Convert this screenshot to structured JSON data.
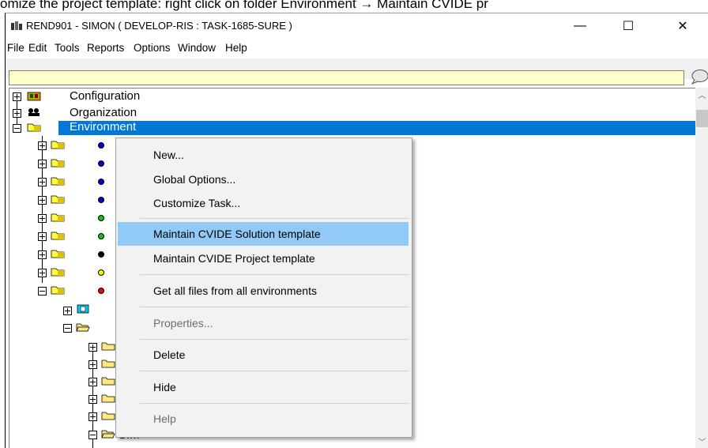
{
  "doc_line": "omize the project template: right click on folder Environment → Maintain CVIDE pr",
  "window": {
    "title": "REND901 - SIMON ( DEVELOP-RIS : TASK-1685-SURE )",
    "minimize": "—",
    "maximize": "☐",
    "close": "✕"
  },
  "menubar": [
    "File",
    "Edit",
    "Tools",
    "Reports",
    "Options",
    "Window",
    "Help"
  ],
  "command_input": {
    "value": ""
  },
  "tree": {
    "configuration": "Configuration",
    "organization": "Organization",
    "environment": "Environment",
    "sim": "SIM",
    "dot_colors": [
      "#0000cc",
      "#0000cc",
      "#0000cc",
      "#0000cc",
      "#00cc00",
      "#00cc00",
      "#000000",
      "#ffff00",
      "#ff0000"
    ]
  },
  "context_menu": {
    "items": [
      {
        "label": "New...",
        "state": "normal"
      },
      {
        "label": "Global Options...",
        "state": "normal"
      },
      {
        "label": "Customize Task...",
        "state": "normal"
      },
      {
        "label": "Maintain CVIDE Solution template",
        "state": "highlighted"
      },
      {
        "label": "Maintain CVIDE Project template",
        "state": "normal"
      },
      {
        "label": "Get all files from all environments",
        "state": "normal"
      },
      {
        "label": "Properties...",
        "state": "disabled"
      },
      {
        "label": "Delete",
        "state": "normal"
      },
      {
        "label": "Hide",
        "state": "normal"
      },
      {
        "label": "Help",
        "state": "disabled"
      }
    ]
  },
  "colors": {
    "selection": "#0078d7",
    "menu_highlight": "#91c9f7",
    "input_bg": "#ffffc8"
  }
}
